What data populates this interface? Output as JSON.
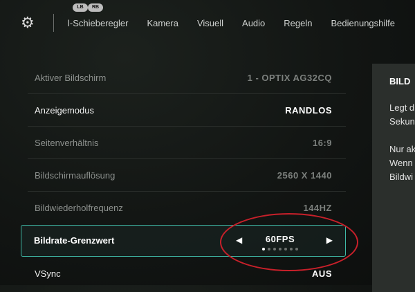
{
  "header": {
    "gear_icon": "gear-icon",
    "bumper_left": "LB",
    "bumper_right": "RB",
    "tabs": [
      {
        "label": "l-Schieberegler"
      },
      {
        "label": "Kamera"
      },
      {
        "label": "Visuell"
      },
      {
        "label": "Audio"
      },
      {
        "label": "Regeln"
      },
      {
        "label": "Bedienungshilfe"
      }
    ]
  },
  "settings": {
    "rows": [
      {
        "label": "Aktiver Bildschirm",
        "value": "1 - OPTIX AG32CQ"
      },
      {
        "label": "Anzeigemodus",
        "value": "RANDLOS"
      },
      {
        "label": "Seitenverhältnis",
        "value": "16:9"
      },
      {
        "label": "Bildschirmauflösung",
        "value": "2560 X 1440"
      },
      {
        "label": "Bildwiederholfrequenz",
        "value": "144HZ"
      },
      {
        "label": "Bildrate-Grenzwert",
        "value": "60FPS"
      },
      {
        "label": "VSync",
        "value": "AUS"
      }
    ],
    "selected_index": 5,
    "selector": {
      "left_arrow": "◀",
      "right_arrow": "▶",
      "dot_count": 7,
      "active_dot": 0
    }
  },
  "panel": {
    "title": "BILD",
    "lines": [
      "Legt d",
      "Sekun",
      "Nur ak",
      "Wenn",
      "Bildwi"
    ]
  },
  "colors": {
    "accent": "#3fb9a6",
    "annotation": "#c8202a"
  }
}
